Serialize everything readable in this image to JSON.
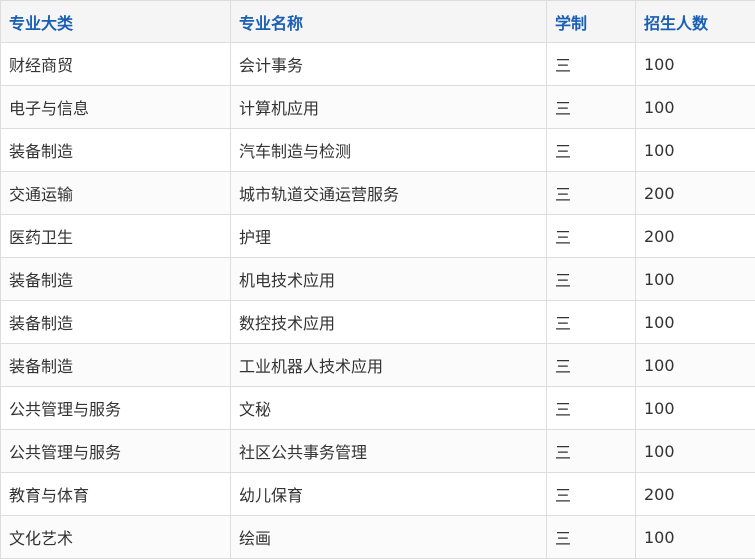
{
  "table": {
    "headers": [
      "专业大类",
      "专业名称",
      "学制",
      "招生人数"
    ],
    "rows": [
      [
        "财经商贸",
        "会计事务",
        "三",
        "100"
      ],
      [
        "电子与信息",
        "计算机应用",
        "三",
        "100"
      ],
      [
        "装备制造",
        "汽车制造与检测",
        "三",
        "100"
      ],
      [
        "交通运输",
        "城市轨道交通运营服务",
        "三",
        "200"
      ],
      [
        "医药卫生",
        "护理",
        "三",
        "200"
      ],
      [
        "装备制造",
        "机电技术应用",
        "三",
        "100"
      ],
      [
        "装备制造",
        "数控技术应用",
        "三",
        "100"
      ],
      [
        "装备制造",
        "工业机器人技术应用",
        "三",
        "100"
      ],
      [
        "公共管理与服务",
        "文秘",
        "三",
        "100"
      ],
      [
        "公共管理与服务",
        "社区公共事务管理",
        "三",
        "100"
      ],
      [
        "教育与体育",
        "幼儿保育",
        "三",
        "200"
      ],
      [
        "文化艺术",
        "绘画",
        "三",
        "100"
      ]
    ]
  }
}
